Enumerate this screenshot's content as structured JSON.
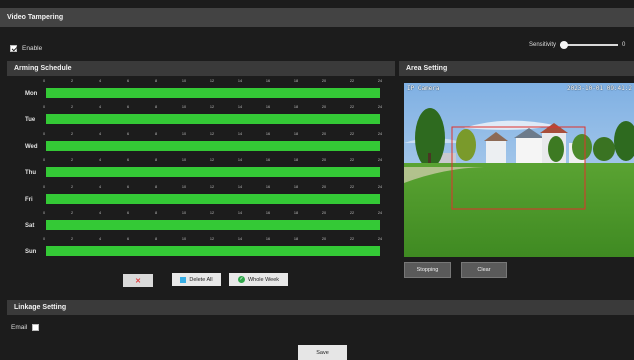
{
  "header": {
    "title": "Video Tampering"
  },
  "enable": {
    "label": "Enable",
    "checked": true
  },
  "sensitivity": {
    "label": "Sensitivity",
    "value_text": "0",
    "level": 0
  },
  "arming": {
    "title": "Arming Schedule",
    "ticks": [
      "0",
      "2",
      "4",
      "6",
      "8",
      "10",
      "12",
      "14",
      "16",
      "18",
      "20",
      "22",
      "24"
    ],
    "days": [
      {
        "label": "Mon"
      },
      {
        "label": "Tue"
      },
      {
        "label": "Wed"
      },
      {
        "label": "Thu"
      },
      {
        "label": "Fri"
      },
      {
        "label": "Sat"
      },
      {
        "label": "Sun"
      }
    ],
    "bar_color": "#34c936",
    "buttons": {
      "delete_all": "Delete All",
      "whole_week": "Whole Week"
    }
  },
  "area": {
    "title": "Area Setting",
    "osd_left": "IP Camera",
    "osd_right": "2023-10-01 09:41:2",
    "buttons": {
      "stop": "Stopping",
      "clear": "Clear"
    }
  },
  "linkage": {
    "title": "Linkage Setting",
    "email_label": "Email",
    "email_checked": false
  },
  "footer": {
    "save": "Save"
  }
}
